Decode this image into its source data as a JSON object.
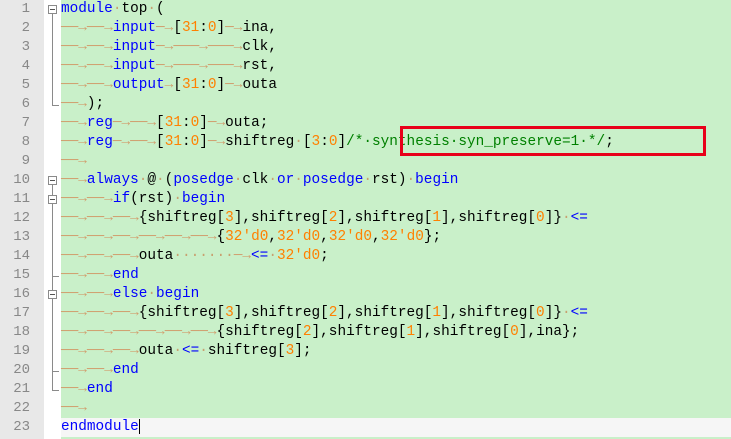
{
  "colors": {
    "keyword": "#0000ff",
    "number": "#ff8000",
    "comment": "#008000",
    "highlight_box": "#e8001a",
    "code_background": "#c9f0c9"
  },
  "line_numbers": [
    "1",
    "2",
    "3",
    "4",
    "5",
    "6",
    "7",
    "8",
    "9",
    "10",
    "11",
    "12",
    "13",
    "14",
    "15",
    "16",
    "17",
    "18",
    "19",
    "20",
    "21",
    "22",
    "23"
  ],
  "lines": [
    [
      {
        "t": "module",
        "c": "kw"
      },
      {
        "t": "·",
        "c": "dt"
      },
      {
        "t": "top",
        "c": ""
      },
      {
        "t": "·",
        "c": "dt"
      },
      {
        "t": "(",
        "c": ""
      }
    ],
    [
      {
        "t": "──→",
        "c": "ar"
      },
      {
        "t": "──→",
        "c": "ar"
      },
      {
        "t": "input",
        "c": "kw"
      },
      {
        "t": "─→",
        "c": "ar"
      },
      {
        "t": "[",
        "c": ""
      },
      {
        "t": "31",
        "c": "num"
      },
      {
        "t": ":",
        "c": ""
      },
      {
        "t": "0",
        "c": "num"
      },
      {
        "t": "]",
        "c": ""
      },
      {
        "t": "─→",
        "c": "ar"
      },
      {
        "t": "ina,",
        "c": ""
      }
    ],
    [
      {
        "t": "──→",
        "c": "ar"
      },
      {
        "t": "──→",
        "c": "ar"
      },
      {
        "t": "input",
        "c": "kw"
      },
      {
        "t": "─→",
        "c": "ar"
      },
      {
        "t": "───→",
        "c": "ar"
      },
      {
        "t": "───→",
        "c": "ar"
      },
      {
        "t": "clk,",
        "c": ""
      }
    ],
    [
      {
        "t": "──→",
        "c": "ar"
      },
      {
        "t": "──→",
        "c": "ar"
      },
      {
        "t": "input",
        "c": "kw"
      },
      {
        "t": "─→",
        "c": "ar"
      },
      {
        "t": "───→",
        "c": "ar"
      },
      {
        "t": "───→",
        "c": "ar"
      },
      {
        "t": "rst,",
        "c": ""
      }
    ],
    [
      {
        "t": "──→",
        "c": "ar"
      },
      {
        "t": "──→",
        "c": "ar"
      },
      {
        "t": "output",
        "c": "kw"
      },
      {
        "t": "→",
        "c": "ar"
      },
      {
        "t": "[",
        "c": ""
      },
      {
        "t": "31",
        "c": "num"
      },
      {
        "t": ":",
        "c": ""
      },
      {
        "t": "0",
        "c": "num"
      },
      {
        "t": "]",
        "c": ""
      },
      {
        "t": "─→",
        "c": "ar"
      },
      {
        "t": "outa",
        "c": ""
      }
    ],
    [
      {
        "t": "──→",
        "c": "ar"
      },
      {
        "t": ");",
        "c": ""
      }
    ],
    [
      {
        "t": "──→",
        "c": "ar"
      },
      {
        "t": "reg",
        "c": "kw"
      },
      {
        "t": "─→",
        "c": "ar"
      },
      {
        "t": "──→",
        "c": "ar"
      },
      {
        "t": "[",
        "c": ""
      },
      {
        "t": "31",
        "c": "num"
      },
      {
        "t": ":",
        "c": ""
      },
      {
        "t": "0",
        "c": "num"
      },
      {
        "t": "]",
        "c": ""
      },
      {
        "t": "─→",
        "c": "ar"
      },
      {
        "t": "outa;",
        "c": ""
      }
    ],
    [
      {
        "t": "──→",
        "c": "ar"
      },
      {
        "t": "reg",
        "c": "kw"
      },
      {
        "t": "─→",
        "c": "ar"
      },
      {
        "t": "──→",
        "c": "ar"
      },
      {
        "t": "[",
        "c": ""
      },
      {
        "t": "31",
        "c": "num"
      },
      {
        "t": ":",
        "c": ""
      },
      {
        "t": "0",
        "c": "num"
      },
      {
        "t": "]",
        "c": ""
      },
      {
        "t": "─→",
        "c": "ar"
      },
      {
        "t": "shiftreg",
        "c": ""
      },
      {
        "t": "·",
        "c": "dt"
      },
      {
        "t": "[",
        "c": ""
      },
      {
        "t": "3",
        "c": "num"
      },
      {
        "t": ":",
        "c": ""
      },
      {
        "t": "0",
        "c": "num"
      },
      {
        "t": "]",
        "c": ""
      },
      {
        "t": "/*·synthesis·syn_preserve=1·*/",
        "c": "cm"
      },
      {
        "t": ";",
        "c": ""
      }
    ],
    [
      {
        "t": "──→",
        "c": "ar"
      }
    ],
    [
      {
        "t": "──→",
        "c": "ar"
      },
      {
        "t": "always",
        "c": "kw"
      },
      {
        "t": "·",
        "c": "dt"
      },
      {
        "t": "@",
        "c": ""
      },
      {
        "t": "·",
        "c": "dt"
      },
      {
        "t": "(",
        "c": ""
      },
      {
        "t": "posedge",
        "c": "kw"
      },
      {
        "t": "·",
        "c": "dt"
      },
      {
        "t": "clk",
        "c": ""
      },
      {
        "t": "·",
        "c": "dt"
      },
      {
        "t": "or",
        "c": "kw"
      },
      {
        "t": "·",
        "c": "dt"
      },
      {
        "t": "posedge",
        "c": "kw"
      },
      {
        "t": "·",
        "c": "dt"
      },
      {
        "t": "rst)",
        "c": ""
      },
      {
        "t": "·",
        "c": "dt"
      },
      {
        "t": "begin",
        "c": "kw"
      }
    ],
    [
      {
        "t": "──→",
        "c": "ar"
      },
      {
        "t": "──→",
        "c": "ar"
      },
      {
        "t": "if",
        "c": "kw"
      },
      {
        "t": "(rst)",
        "c": ""
      },
      {
        "t": "·",
        "c": "dt"
      },
      {
        "t": "begin",
        "c": "kw"
      }
    ],
    [
      {
        "t": "──→",
        "c": "ar"
      },
      {
        "t": "──→",
        "c": "ar"
      },
      {
        "t": "──→",
        "c": "ar"
      },
      {
        "t": "{shiftreg[",
        "c": ""
      },
      {
        "t": "3",
        "c": "num"
      },
      {
        "t": "],shiftreg[",
        "c": ""
      },
      {
        "t": "2",
        "c": "num"
      },
      {
        "t": "],shiftreg[",
        "c": ""
      },
      {
        "t": "1",
        "c": "num"
      },
      {
        "t": "],shiftreg[",
        "c": ""
      },
      {
        "t": "0",
        "c": "num"
      },
      {
        "t": "]}",
        "c": ""
      },
      {
        "t": "·",
        "c": "dt"
      },
      {
        "t": "<=",
        "c": "kw"
      }
    ],
    [
      {
        "t": "──→",
        "c": "ar"
      },
      {
        "t": "──→",
        "c": "ar"
      },
      {
        "t": "──→",
        "c": "ar"
      },
      {
        "t": "──→",
        "c": "ar"
      },
      {
        "t": "──→",
        "c": "ar"
      },
      {
        "t": "──→",
        "c": "ar"
      },
      {
        "t": "{",
        "c": ""
      },
      {
        "t": "32'd0",
        "c": "num"
      },
      {
        "t": ",",
        "c": ""
      },
      {
        "t": "32'd0",
        "c": "num"
      },
      {
        "t": ",",
        "c": ""
      },
      {
        "t": "32'd0",
        "c": "num"
      },
      {
        "t": ",",
        "c": ""
      },
      {
        "t": "32'd0",
        "c": "num"
      },
      {
        "t": "};",
        "c": ""
      }
    ],
    [
      {
        "t": "──→",
        "c": "ar"
      },
      {
        "t": "──→",
        "c": "ar"
      },
      {
        "t": "──→",
        "c": "ar"
      },
      {
        "t": "outa",
        "c": ""
      },
      {
        "t": "·······",
        "c": "dt"
      },
      {
        "t": "─→",
        "c": "ar"
      },
      {
        "t": "<=",
        "c": "kw"
      },
      {
        "t": "·",
        "c": "dt"
      },
      {
        "t": "32'd0",
        "c": "num"
      },
      {
        "t": ";",
        "c": ""
      }
    ],
    [
      {
        "t": "──→",
        "c": "ar"
      },
      {
        "t": "──→",
        "c": "ar"
      },
      {
        "t": "end",
        "c": "kw"
      }
    ],
    [
      {
        "t": "──→",
        "c": "ar"
      },
      {
        "t": "──→",
        "c": "ar"
      },
      {
        "t": "else",
        "c": "kw"
      },
      {
        "t": "·",
        "c": "dt"
      },
      {
        "t": "begin",
        "c": "kw"
      }
    ],
    [
      {
        "t": "──→",
        "c": "ar"
      },
      {
        "t": "──→",
        "c": "ar"
      },
      {
        "t": "──→",
        "c": "ar"
      },
      {
        "t": "{shiftreg[",
        "c": ""
      },
      {
        "t": "3",
        "c": "num"
      },
      {
        "t": "],shiftreg[",
        "c": ""
      },
      {
        "t": "2",
        "c": "num"
      },
      {
        "t": "],shiftreg[",
        "c": ""
      },
      {
        "t": "1",
        "c": "num"
      },
      {
        "t": "],shiftreg[",
        "c": ""
      },
      {
        "t": "0",
        "c": "num"
      },
      {
        "t": "]}",
        "c": ""
      },
      {
        "t": "·",
        "c": "dt"
      },
      {
        "t": "<=",
        "c": "kw"
      }
    ],
    [
      {
        "t": "──→",
        "c": "ar"
      },
      {
        "t": "──→",
        "c": "ar"
      },
      {
        "t": "──→",
        "c": "ar"
      },
      {
        "t": "──→",
        "c": "ar"
      },
      {
        "t": "──→",
        "c": "ar"
      },
      {
        "t": "──→",
        "c": "ar"
      },
      {
        "t": "{shiftreg[",
        "c": ""
      },
      {
        "t": "2",
        "c": "num"
      },
      {
        "t": "],shiftreg[",
        "c": ""
      },
      {
        "t": "1",
        "c": "num"
      },
      {
        "t": "],shiftreg[",
        "c": ""
      },
      {
        "t": "0",
        "c": "num"
      },
      {
        "t": "],ina};",
        "c": ""
      }
    ],
    [
      {
        "t": "──→",
        "c": "ar"
      },
      {
        "t": "──→",
        "c": "ar"
      },
      {
        "t": "──→",
        "c": "ar"
      },
      {
        "t": "outa",
        "c": ""
      },
      {
        "t": "·",
        "c": "dt"
      },
      {
        "t": "<=",
        "c": "kw"
      },
      {
        "t": "·",
        "c": "dt"
      },
      {
        "t": "shiftreg[",
        "c": ""
      },
      {
        "t": "3",
        "c": "num"
      },
      {
        "t": "];",
        "c": ""
      }
    ],
    [
      {
        "t": "──→",
        "c": "ar"
      },
      {
        "t": "──→",
        "c": "ar"
      },
      {
        "t": "end",
        "c": "kw"
      }
    ],
    [
      {
        "t": "──→",
        "c": "ar"
      },
      {
        "t": "end",
        "c": "kw"
      }
    ],
    [
      {
        "t": "──→",
        "c": "ar"
      }
    ],
    [
      {
        "t": "endmodule",
        "c": "kw"
      }
    ]
  ]
}
